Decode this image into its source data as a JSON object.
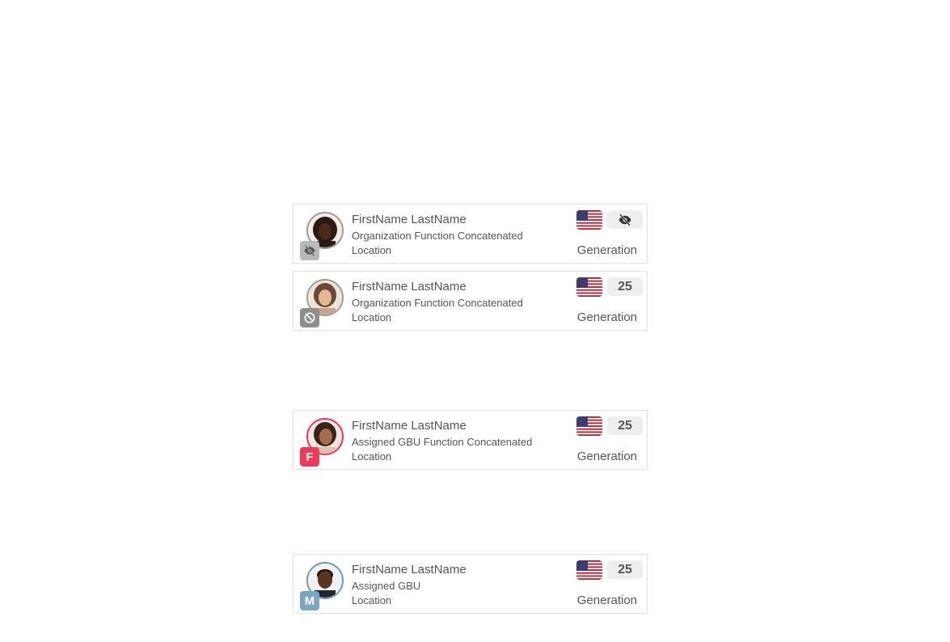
{
  "cards": [
    {
      "name": "FirstName LastName",
      "org": "Organization Function Concatenated",
      "location": "Location",
      "generation_label": "Generation",
      "pill_icon": "eye-off-icon",
      "avatar_ring": "#9a9a9a",
      "badge_icon": "eye-off-icon",
      "badge_color": "#b8b8b8"
    },
    {
      "name": "FirstName LastName",
      "org": "Organization Function Concatenated",
      "location": "Location",
      "generation_label": "Generation",
      "pill_value": "25",
      "avatar_ring": "#9a9a9a",
      "badge_icon": "blocked-icon",
      "badge_color": "#8e8e8e"
    },
    {
      "name": "FirstName LastName",
      "org": "Assigned GBU Function Concatenated",
      "location": "Location",
      "generation_label": "Generation",
      "pill_value": "25",
      "avatar_ring": "#e8375a",
      "badge_text": "F",
      "badge_color": "#f0385b"
    },
    {
      "name": "FirstName LastName",
      "org": "Assigned GBU",
      "location": "Location",
      "generation_label": "Generation",
      "pill_value": "25",
      "avatar_ring": "#6c9cbc",
      "badge_text": "M",
      "badge_color": "#79a6c4"
    }
  ],
  "flag_icon": "us-flag-icon"
}
